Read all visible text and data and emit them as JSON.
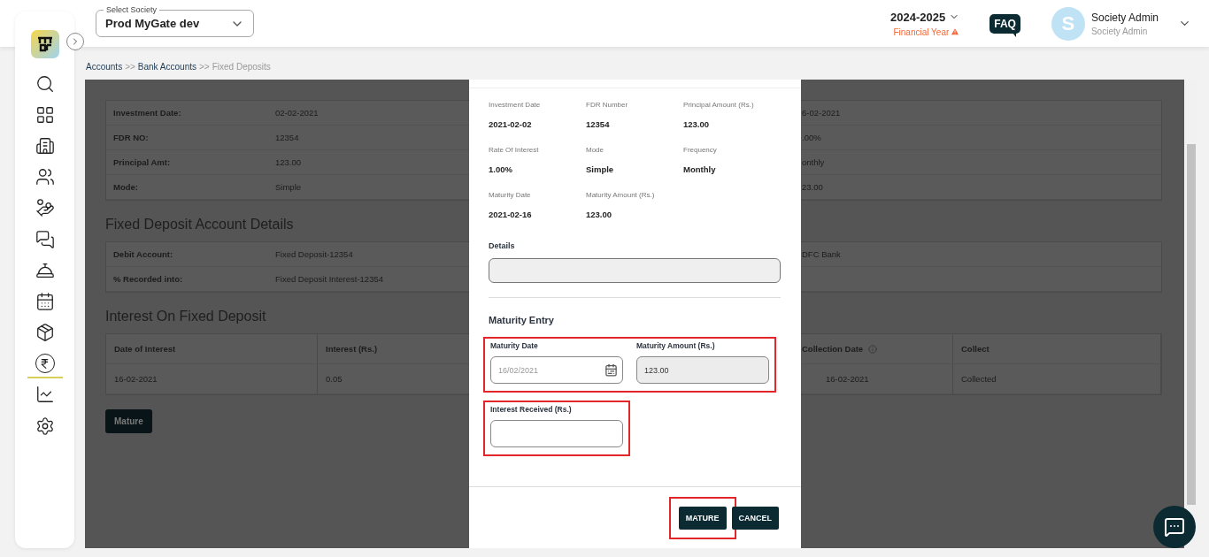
{
  "sidebar": {
    "items": [
      {
        "selected": false
      },
      {
        "selected": false
      },
      {
        "selected": false
      },
      {
        "selected": false
      },
      {
        "selected": false
      },
      {
        "selected": false
      },
      {
        "selected": false
      },
      {
        "selected": false
      },
      {
        "selected": false
      },
      {
        "selected": true
      },
      {
        "selected": false
      },
      {
        "selected": false
      }
    ]
  },
  "header": {
    "society_select": {
      "label": "Select Society",
      "value": "Prod MyGate dev"
    },
    "year": "2024-2025",
    "year_note": "Financial Year",
    "faq": "FAQ",
    "user": {
      "initial": "S",
      "name": "Society Admin",
      "role": "Society Admin"
    }
  },
  "breadcrumb": [
    {
      "kind": "link",
      "text": "Accounts"
    },
    {
      "kind": "sep",
      "text": ">>"
    },
    {
      "kind": "link",
      "text": "Bank Accounts"
    },
    {
      "kind": "sep",
      "text": ">>"
    },
    {
      "kind": "current",
      "text": "Fixed Deposits"
    }
  ],
  "fd_details": {
    "rows": [
      {
        "label": "Investment Date:",
        "value": "02-02-2021",
        "right_value": "6-02-2021"
      },
      {
        "label": "FDR NO:",
        "value": "12354",
        "right_value": ".00%"
      },
      {
        "label": "Principal Amt:",
        "value": "123.00",
        "right_value": "onthly"
      },
      {
        "label": "Mode:",
        "value": "Simple",
        "right_value": "23.00"
      }
    ]
  },
  "account_section": {
    "title": "Fixed Deposit Account Details",
    "rows": [
      {
        "label": "Debit Account:",
        "value": "Fixed Deposit-12354",
        "right_value": "DFC Bank"
      },
      {
        "label": "% Recorded into:",
        "value": "Fixed Deposit Interest-12354"
      }
    ]
  },
  "interest_section": {
    "title": "Interest On Fixed Deposit",
    "columns": [
      {
        "label": "Date of Interest"
      },
      {
        "label": "Interest (Rs.)"
      },
      {
        "label": "Collection Date",
        "info": true
      },
      {
        "label": "Collect"
      }
    ],
    "rows": [
      [
        "16-02-2021",
        "0.05",
        "16-02-2021",
        "Collected"
      ]
    ]
  },
  "mature_button": "Mature",
  "modal": {
    "summary": [
      {
        "label": "Investment Date",
        "value": "2021-02-02"
      },
      {
        "label": "FDR Number",
        "value": "12354"
      },
      {
        "label": "Principal Amount (Rs.)",
        "value": "123.00"
      },
      {
        "label": "Rate Of Interest",
        "value": "1.00%"
      },
      {
        "label": "Mode",
        "value": "Simple"
      },
      {
        "label": "Frequency",
        "value": "Monthly"
      },
      {
        "label": "Maturity Date",
        "value": "2021-02-16"
      },
      {
        "label": "Maturity Amount (Rs.)",
        "value": "123.00"
      }
    ],
    "details": {
      "label": "Details",
      "disabled": true
    },
    "entry_title": "Maturity Entry",
    "groups": [
      {
        "highlighted": true,
        "fields": [
          {
            "kind": "date",
            "label": "Maturity Date",
            "value": "16/02/2021",
            "disabled": false
          },
          {
            "kind": "text",
            "label": "Maturity Amount (Rs.)",
            "value": "123.00",
            "disabled": true
          }
        ]
      },
      {
        "highlighted": true,
        "fields": [
          {
            "kind": "text",
            "label": "Interest Received (Rs.)",
            "disabled": false
          }
        ]
      }
    ],
    "buttons": [
      {
        "label": "MATURE",
        "highlighted": true
      },
      {
        "label": "CANCEL",
        "highlighted": false
      }
    ]
  }
}
